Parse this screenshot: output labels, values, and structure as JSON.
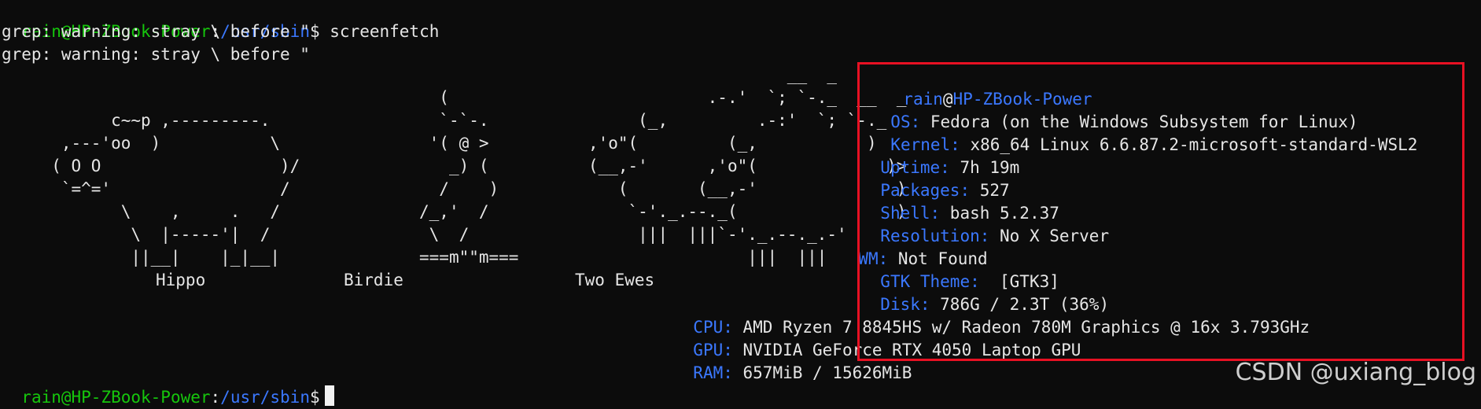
{
  "prompt": {
    "user_host": "rain@HP-ZBook-Power",
    "colon": ":",
    "path": "/usr/sbin",
    "dollar": "$"
  },
  "command": "screenfetch",
  "warnings": [
    "grep: warning: stray \\ before \"",
    "grep: warning: stray \\ before \""
  ],
  "ascii_art": [
    "                                                                               __  _",
    "                                            (                          .-.'  `; `-._  __  _",
    "           c~~p ,---------.                 `-`-.               (_,         .-:'  `; `-._",
    "      ,---'oo  )           \\               '( @ >          ,'o\"(         (_,           )",
    "     ( O O                  )/               _) (          (__,-'      ,'o\"(             )>",
    "      `=^='                 /               /    )            (       (__,-'              )",
    "            \\    ,     .   /              /_,'  /              `-'._.--._(                )",
    "             \\  |-----'|  /                \\  /                 |||  |||`-'._.--._.-'",
    "             ||__|    |_|__|              ===m\"\"m===                       |||  |||"
  ],
  "art_labels": [
    "Hippo",
    "Birdie",
    "Two Ewes"
  ],
  "info_header": {
    "user": "rain",
    "at": "@",
    "host": "HP-ZBook-Power"
  },
  "info": [
    {
      "key": "OS:",
      "value": " Fedora (on the Windows Subsystem for Linux)"
    },
    {
      "key": "Kernel:",
      "value": " x86_64 Linux 6.6.87.2-microsoft-standard-WSL2"
    },
    {
      "key": "Uptime:",
      "value": " 7h 19m"
    },
    {
      "key": "Packages:",
      "value": " 527"
    },
    {
      "key": "Shell:",
      "value": " bash 5.2.37"
    },
    {
      "key": "Resolution:",
      "value": " No X Server"
    },
    {
      "key": "WM:",
      "value": " Not Found"
    },
    {
      "key": "GTK Theme:",
      "value": "  [GTK3]"
    },
    {
      "key": "Disk:",
      "value": " 786G / 2.3T (36%)"
    },
    {
      "key": "CPU:",
      "value": " AMD Ryzen 7 8845HS w/ Radeon 780M Graphics @ 16x 3.793GHz"
    },
    {
      "key": "GPU:",
      "value": " NVIDIA GeForce RTX 4050 Laptop GPU"
    },
    {
      "key": "RAM:",
      "value": " 657MiB / 15626MiB"
    }
  ],
  "watermark": "CSDN @uxiang_blog",
  "colors": {
    "background": "#0c0c0c",
    "text": "#e6e6e6",
    "green": "#16c60c",
    "blue": "#3b78ff",
    "annotation": "#e81123"
  }
}
